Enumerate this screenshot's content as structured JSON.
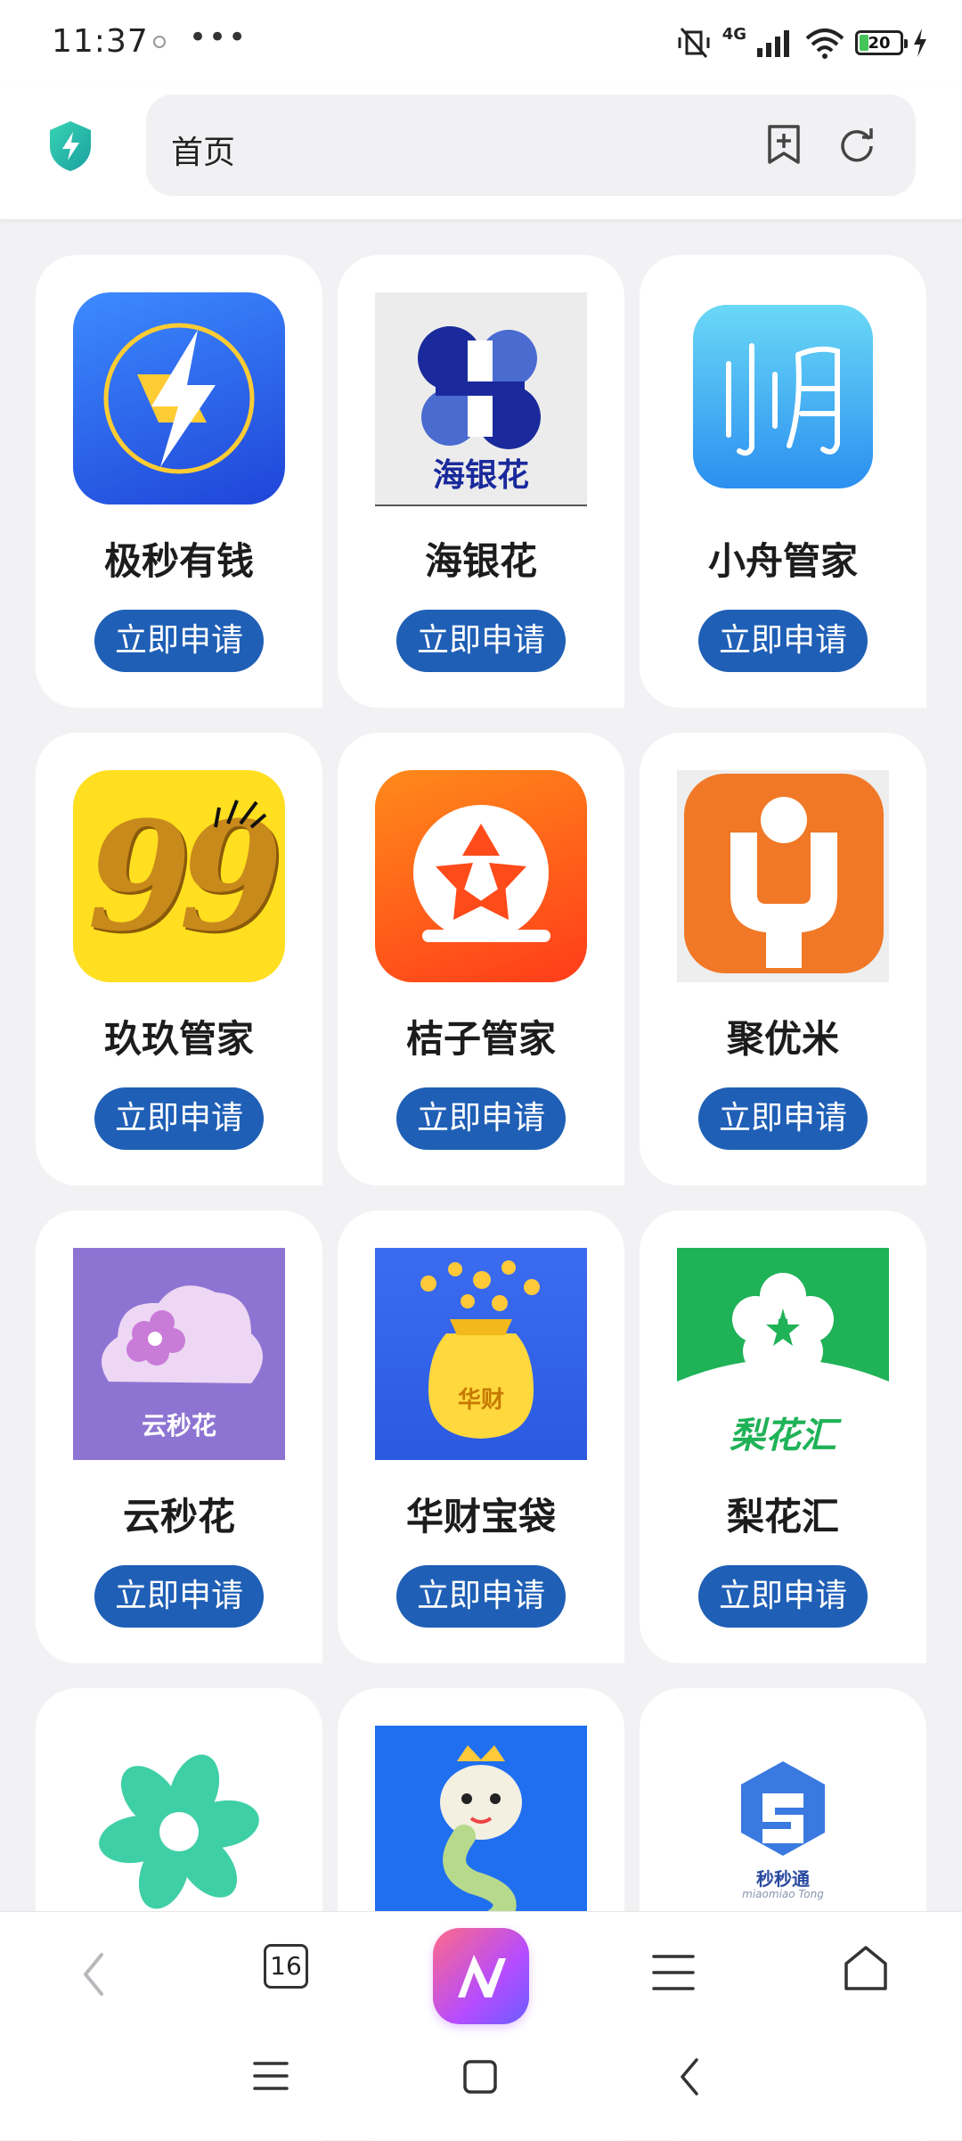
{
  "status_bar": {
    "time": "11:37",
    "more": "•••",
    "network": "4G",
    "battery": "20"
  },
  "address_bar": {
    "url_text": "首页",
    "security_icon": "shield-bolt-icon",
    "bookmark_icon": "add-bookmark-icon",
    "refresh_icon": "refresh-icon"
  },
  "apps": [
    {
      "name": "极秒有钱",
      "button": "立即申请",
      "icon": "lightning-icon"
    },
    {
      "name": "海银花",
      "button": "立即申请",
      "icon": "haiyinhua-logo",
      "logo_text": "海银花"
    },
    {
      "name": "小舟管家",
      "button": "立即申请",
      "icon": "xiaozhou-logo"
    },
    {
      "name": "玖玖管家",
      "button": "立即申请",
      "icon": "ninety-nine-logo",
      "logo_text": "99"
    },
    {
      "name": "桔子管家",
      "button": "立即申请",
      "icon": "film-reel-logo"
    },
    {
      "name": "聚优米",
      "button": "立即申请",
      "icon": "juyoumi-logo"
    },
    {
      "name": "云秒花",
      "button": "立即申请",
      "icon": "cloud-flower-logo",
      "logo_text": "云秒花"
    },
    {
      "name": "华财宝袋",
      "button": "立即申请",
      "icon": "money-bag-logo",
      "logo_text": "华财"
    },
    {
      "name": "梨花汇",
      "button": "立即申请",
      "icon": "pear-flower-logo",
      "logo_text": "梨花汇"
    },
    {
      "name": "",
      "button": "",
      "icon": "green-swirl-logo"
    },
    {
      "name": "",
      "button": "",
      "icon": "snake-logo"
    },
    {
      "name": "",
      "button": "",
      "icon": "miaomiaotong-logo",
      "logo_text": "秒秒通",
      "logo_subtext": "miaomiao Tong"
    }
  ],
  "bottom_nav": {
    "tab_count": "16",
    "back_icon": "chevron-left-icon",
    "menu_icon": "menu-icon",
    "home_icon": "home-icon"
  },
  "colors": {
    "button_bg": "#1f5fb6",
    "page_bg": "#f2f2f4"
  }
}
